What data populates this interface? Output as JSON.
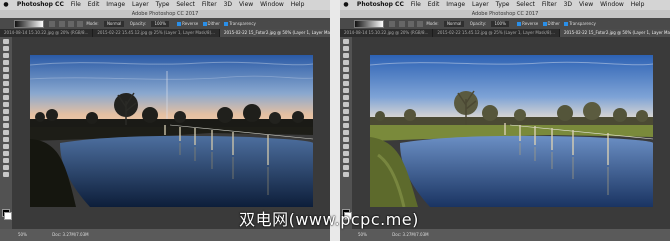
{
  "menubar": {
    "app_name": "Photoshop CC",
    "items": [
      "File",
      "Edit",
      "Image",
      "Layer",
      "Type",
      "Select",
      "Filter",
      "3D",
      "View",
      "Window",
      "Help"
    ]
  },
  "title": "Adobe Photoshop CC 2017",
  "options_bar": {
    "mode_label": "Mode:",
    "mode_value": "Normal",
    "opacity_label": "Opacity:",
    "opacity_value": "100%",
    "reverse_label": "Reverse",
    "dither_label": "Dither",
    "transparency_label": "Transparency"
  },
  "tabs": [
    "2014-08-14 15.10.22.jpg @ 20% (RGB/8...",
    "2015-02-22 15.45.12.jpg @ 25% (Layer 1, Layer Mask/8)...",
    "2015-02-22 15_Fotor2.jpg @ 50% (Layer 1, Layer Mask/8) *"
  ],
  "statusbar": {
    "zoom": "50%",
    "doc": "Doc: 3.27M/7.03M"
  },
  "watermark": "双电网(www.pcpc.me)",
  "colors": {
    "app_bg": "#3b3b3b",
    "menubar": "#d4d4d4",
    "options_bar": "#4a4a4a",
    "active_tab": "#4c4c4c",
    "toolbar": "#525252",
    "sky_top": "#2e5fa8",
    "sky_horizon": "#e6c3a4"
  },
  "icons": [
    "apple-icon",
    "gradient-tool-icon",
    "move-tool-icon",
    "marquee-tool-icon",
    "lasso-tool-icon",
    "crop-tool-icon",
    "brush-tool-icon",
    "eraser-tool-icon",
    "pen-tool-icon",
    "type-tool-icon",
    "hand-tool-icon",
    "zoom-tool-icon"
  ]
}
